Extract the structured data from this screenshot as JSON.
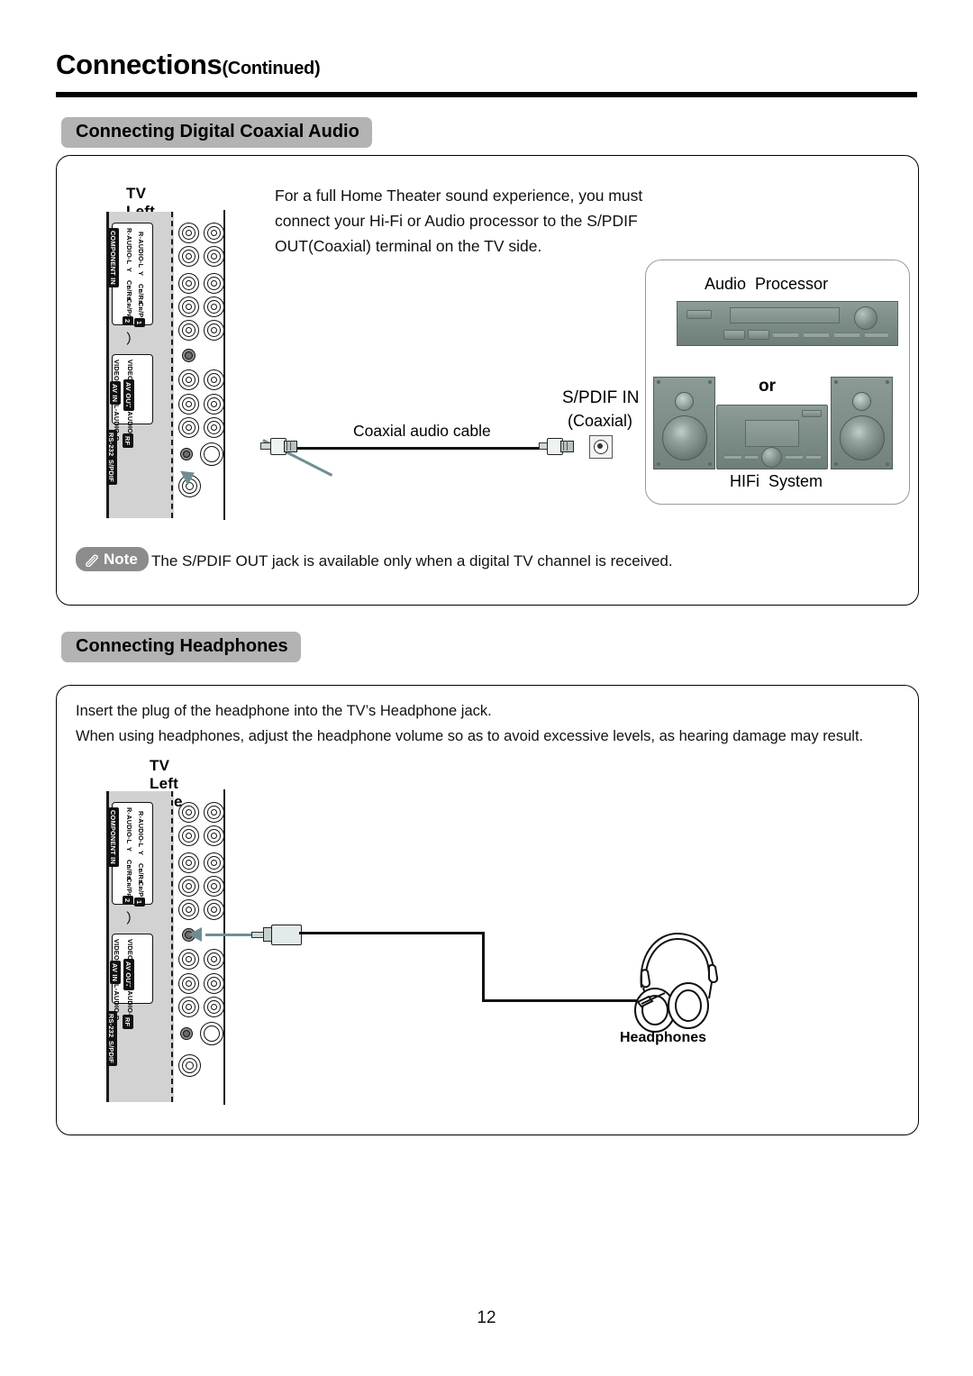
{
  "header": {
    "title": "Connections",
    "continued": "(Continued)"
  },
  "sections": [
    {
      "id": "coaxial",
      "label": "Connecting Digital Coaxial Audio",
      "diagram_caption": "TV Left Side",
      "body_lines": [
        "For  a  full  Home  Theater  sound  experience,  you  must",
        "connect  your  Hi-Fi  or  Audio  processor  to  the  S/PDIF",
        "OUT(Coaxial) terminal on the TV side."
      ],
      "cable_label": "Coaxial audio cable",
      "jack_label_line1": "S/PDIF IN",
      "jack_label_line2": "(Coaxial)",
      "gear": {
        "top_label": "Audio  Processor",
        "middle_label": "or",
        "bottom_label": "HIFi  System"
      },
      "note": {
        "badge": "Note",
        "icon": "pencil-icon",
        "text": "The S/PDIF OUT jack is available only when a digital TV channel is received."
      }
    },
    {
      "id": "headphones",
      "label": "Connecting Headphones",
      "diagram_caption": "TV Left Side",
      "body_lines": [
        "Insert the plug of the headphone into the TV’s Headphone jack.",
        "When using headphones, adjust the headphone volume so as to avoid excessive levels, as hearing damage may result."
      ],
      "device_label": "Headphones"
    }
  ],
  "tv_panel": {
    "component_in": {
      "title": "COMPONENT IN",
      "port2": {
        "number": "2",
        "rows": [
          "R-AUDIO-L",
          "Y",
          "Cʙ/Rʙ",
          "Cʀ/Pʀ"
        ]
      },
      "port1": {
        "number": "1",
        "rows": [
          "R-AUDIO-L",
          "Y",
          "Cʙ/Rʙ",
          "Cʀ/Pʀ"
        ]
      }
    },
    "headphone_jack_icon": "headphone-icon",
    "av_out": {
      "title": "AV OUT",
      "rows": [
        "VIDEO",
        "L-AUDIO-R"
      ]
    },
    "av_in": {
      "title": "AV IN",
      "rows": [
        "VIDEO",
        "L-AUDIO-R"
      ]
    },
    "rs232": "RS-232",
    "rf": "RF",
    "spdif": "S/PDIF"
  },
  "page_number": "12",
  "colors": {
    "accent_arrow": "#6f8e93",
    "pill_gray": "#b3b3b3",
    "panel_gray": "#d2d2d2",
    "note_gray": "#8c8c8c",
    "gear_green": "#7d8d87"
  }
}
